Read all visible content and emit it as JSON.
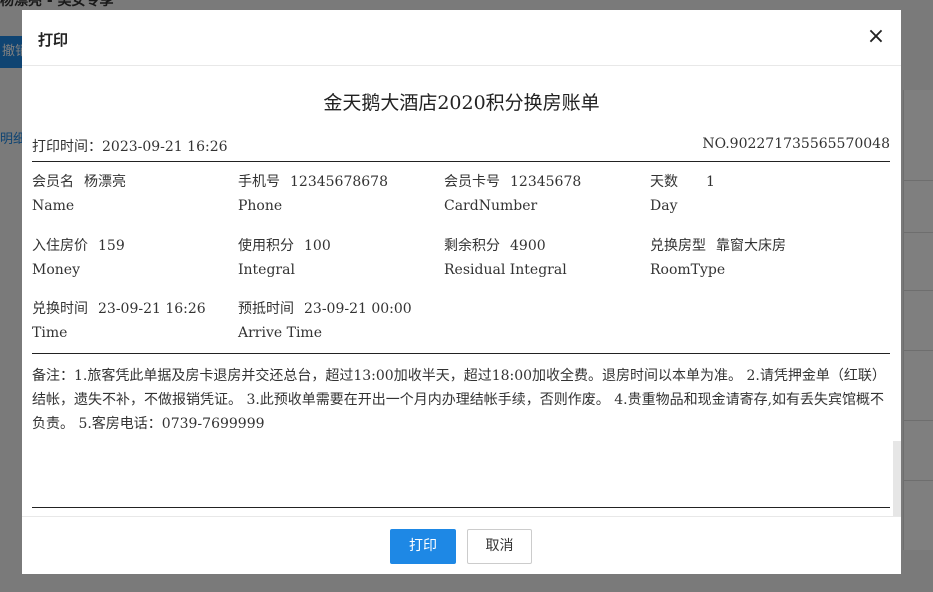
{
  "background": {
    "title": "杨漂亮 - 美女专享",
    "button_label": "撤销",
    "link_label": "明细"
  },
  "modal": {
    "title": "打印",
    "close_icon": "×"
  },
  "receipt": {
    "title": "金天鹅大酒店2020积分换房账单",
    "print_time": "打印时间：2023-09-21 16:26",
    "number": "NO.902271735565570048",
    "fields": [
      {
        "cn": "会员名",
        "val": "杨漂亮",
        "en": "Name"
      },
      {
        "cn": "手机号",
        "val": "12345678678",
        "en": "Phone"
      },
      {
        "cn": "会员卡号",
        "val": "12345678",
        "en": "CardNumber"
      },
      {
        "cn": "天数",
        "val": "1",
        "en": "Day"
      },
      {
        "cn": "入住房价",
        "val": "159",
        "en": "Money"
      },
      {
        "cn": "使用积分",
        "val": "100",
        "en": "Integral"
      },
      {
        "cn": "剩余积分",
        "val": "4900",
        "en": "Residual Integral"
      },
      {
        "cn": "兑换房型",
        "val": "靠窗大床房",
        "en": "RoomType"
      },
      {
        "cn": "兑换时间",
        "val": "23-09-21 16:26",
        "en": "Time"
      },
      {
        "cn": "预抵时间",
        "val": "23-09-21 00:00",
        "en": "Arrive Time"
      }
    ],
    "remark": "备注：1.旅客凭此单据及房卡退房并交还总台，超过13:00加收半天，超过18:00加收全费。退房时间以本单为准。 2.请凭押金单（红联）结帐，遗失不补，不做报销凭证。 3.此预收单需要在开出一个月内办理结帐手续，否则作废。 4.贵重物品和现金请寄存,如有丢失宾馆概不负责。 5.客房电话：0739-7699999"
  },
  "footer": {
    "print_label": "打印",
    "cancel_label": "取消"
  },
  "colors": {
    "primary": "#1e88e5"
  }
}
